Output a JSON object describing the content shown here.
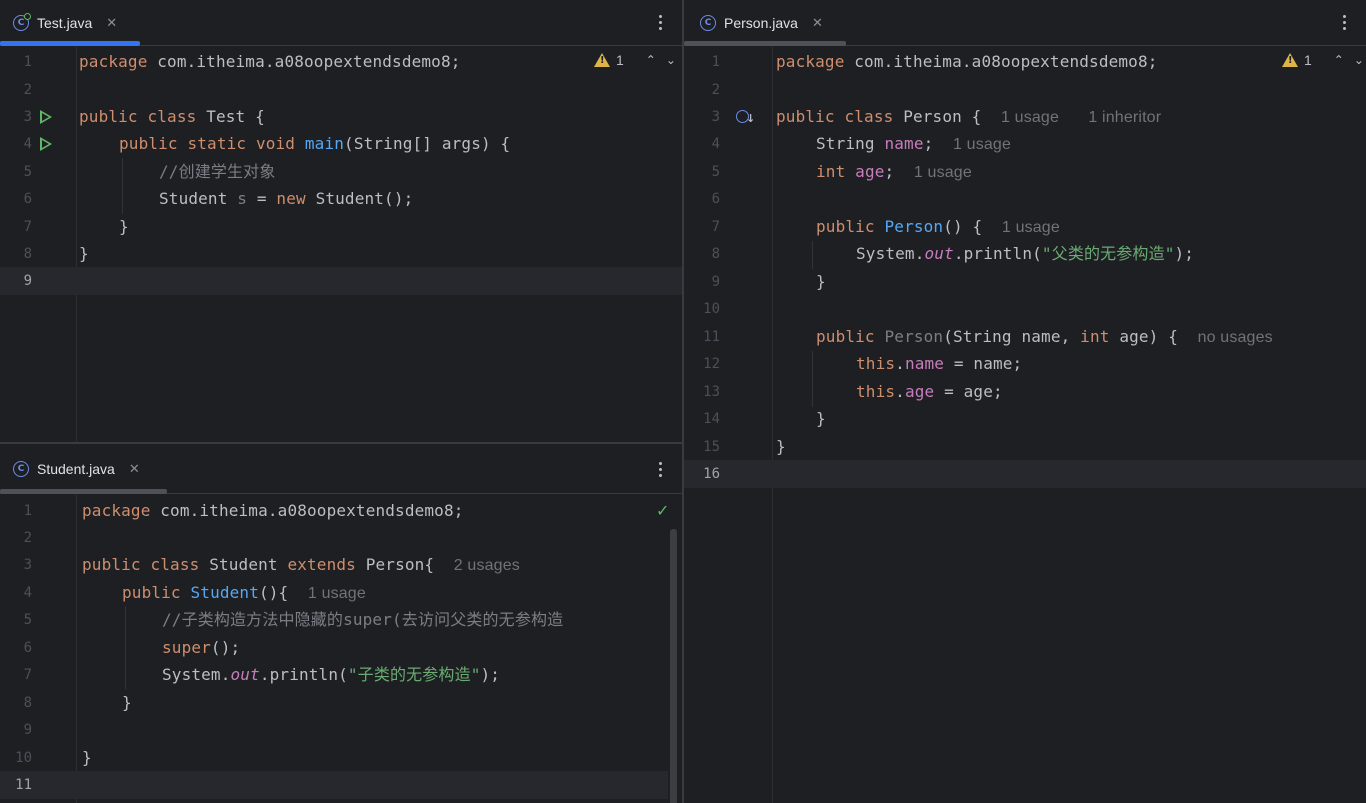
{
  "panes": {
    "test": {
      "tab": {
        "label": "Test.java",
        "close": "✕"
      },
      "inspection": {
        "count": "1"
      },
      "lines": [
        "1",
        "2",
        "3",
        "4",
        "5",
        "6",
        "7",
        "8",
        "9"
      ],
      "code": {
        "l1_kw": "package",
        "l1_pkg": " com.itheima.a08oopextendsdemo8;",
        "l3_kw": "public class",
        "l3_name": " Test {",
        "l4_kw1": "public static void",
        "l4_fn": "main",
        "l4_rest": "(String[] args) {",
        "l5_comment": "//创建学生对象",
        "l6_type": "Student ",
        "l6_var": "s",
        "l6_eq": " = ",
        "l6_new": "new",
        "l6_rest": " Student();",
        "l7": "}",
        "l8": "}"
      }
    },
    "student": {
      "tab": {
        "label": "Student.java",
        "close": "✕"
      },
      "lines": [
        "1",
        "2",
        "3",
        "4",
        "5",
        "6",
        "7",
        "8",
        "9",
        "10",
        "11"
      ],
      "code": {
        "l1_kw": "package",
        "l1_pkg": " com.itheima.a08oopextendsdemo8;",
        "l3_kw": "public class",
        "l3_name": " Student ",
        "l3_ext": "extends",
        "l3_parent": " Person{",
        "l3_hint": "2 usages",
        "l4_kw": "public",
        "l4_fn": "Student",
        "l4_rest": "(){",
        "l4_hint": "1 usage",
        "l5_comment": "//子类构造方法中隐藏的super(去访问父类的无参构造",
        "l6_kw": "super",
        "l6_rest": "();",
        "l7_sys": "System.",
        "l7_out": "out",
        "l7_call": ".println(",
        "l7_str": "\"子类的无参构造\"",
        "l7_end": ");",
        "l8": "}",
        "l10": "}"
      }
    },
    "person": {
      "tab": {
        "label": "Person.java",
        "close": "✕"
      },
      "inspection": {
        "count": "1"
      },
      "lines": [
        "1",
        "2",
        "3",
        "4",
        "5",
        "6",
        "7",
        "8",
        "9",
        "10",
        "11",
        "12",
        "13",
        "14",
        "15",
        "16"
      ],
      "code": {
        "l1_kw": "package",
        "l1_pkg": " com.itheima.a08oopextendsdemo8;",
        "l3_kw": "public class",
        "l3_name": " Person {",
        "l3_hint1": "1 usage",
        "l3_hint2": "1 inheritor",
        "l4_type": "String ",
        "l4_fld": "name",
        "l4_end": ";",
        "l4_hint": "1 usage",
        "l5_kw": "int",
        "l5_fld": "age",
        "l5_end": ";",
        "l5_hint": "1 usage",
        "l7_kw": "public",
        "l7_fn": "Person",
        "l7_rest": "() {",
        "l7_hint": "1 usage",
        "l8_sys": "System.",
        "l8_out": "out",
        "l8_call": ".println(",
        "l8_str": "\"父类的无参构造\"",
        "l8_end": ");",
        "l9": "}",
        "l11_kw": "public",
        "l11_fn": "Person",
        "l11_p1": "(String name, ",
        "l11_int": "int",
        "l11_p2": " age) {",
        "l11_hint": "no usages",
        "l12_this": "this",
        "l12_dot": ".",
        "l12_fld": "name",
        "l12_rest": " = name;",
        "l13_this": "this",
        "l13_dot": ".",
        "l13_fld": "age",
        "l13_rest": " = age;",
        "l14": "}",
        "l15": "}"
      }
    }
  },
  "colors": {
    "keyword": "#cf8e6d",
    "function": "#56a8f5",
    "field": "#c77dbb",
    "string": "#6aab73",
    "comment": "#7a7e85",
    "active_tab": "#3574f0",
    "inactive_tab": "#4e5157"
  }
}
